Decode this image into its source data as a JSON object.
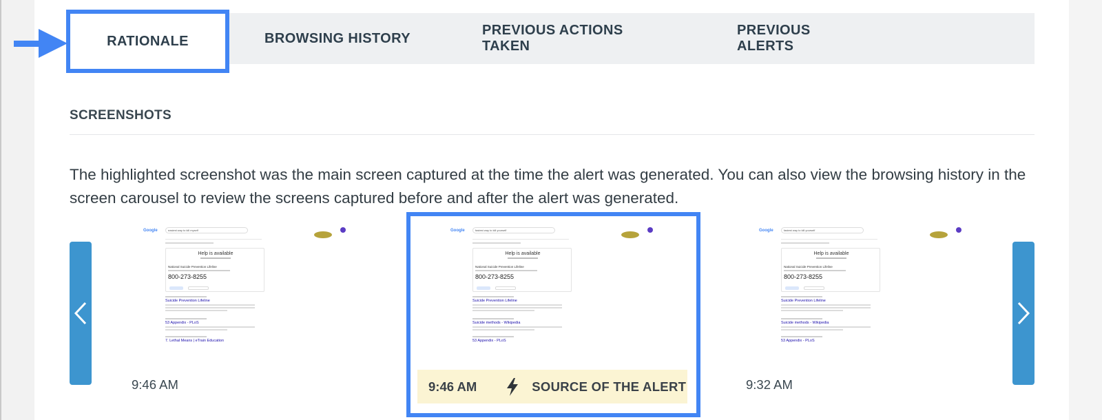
{
  "colors": {
    "accent": "#4285f4",
    "nav": "#3d95cf",
    "alert_band": "#fbf4d3"
  },
  "tabs": [
    {
      "label": "RATIONALE",
      "active": true
    },
    {
      "label": "BROWSING HISTORY",
      "active": false
    },
    {
      "label": "PREVIOUS ACTIONS TAKEN",
      "active": false
    },
    {
      "label": "PREVIOUS ALERTS",
      "active": false
    }
  ],
  "screenshots": {
    "title": "SCREENSHOTS",
    "description": "The highlighted screenshot was the main screen captured at the time the alert was generated. You can also view the browsing history in the screen carousel to review the screens captured before and after the alert was generated.",
    "prev_icon": "chevron-left-icon",
    "next_icon": "chevron-right-icon",
    "items": [
      {
        "time": "9:46 AM",
        "source": false,
        "page": {
          "logo": "Google",
          "query": "easiest way to kill myself",
          "help_title": "Help is available",
          "org": "National Suicide Prevention Lifeline",
          "phone": "800-273-8255",
          "results": [
            "Suicide Prevention Lifeline",
            "53 Appendix - PLoS",
            "7. Lethal Means | eTrain Education"
          ]
        }
      },
      {
        "time": "9:46 AM",
        "source": true,
        "source_label": "SOURCE OF THE ALERT",
        "page": {
          "logo": "Google",
          "query": "fastest way to kill yourself",
          "help_title": "Help is available",
          "org": "National Suicide Prevention Lifeline",
          "phone": "800-273-8255",
          "results": [
            "Suicide Prevention Lifeline",
            "Suicide methods - Wikipedia",
            "53 Appendix - PLoS"
          ]
        }
      },
      {
        "time": "9:32 AM",
        "source": false,
        "page": {
          "logo": "Google",
          "query": "fastest way to kill yourself",
          "help_title": "Help is available",
          "org": "National Suicide Prevention Lifeline",
          "phone": "800-273-8255",
          "results": [
            "Suicide Prevention Lifeline",
            "Suicide methods - Wikipedia",
            "53 Appendix - PLoS"
          ]
        }
      }
    ]
  }
}
